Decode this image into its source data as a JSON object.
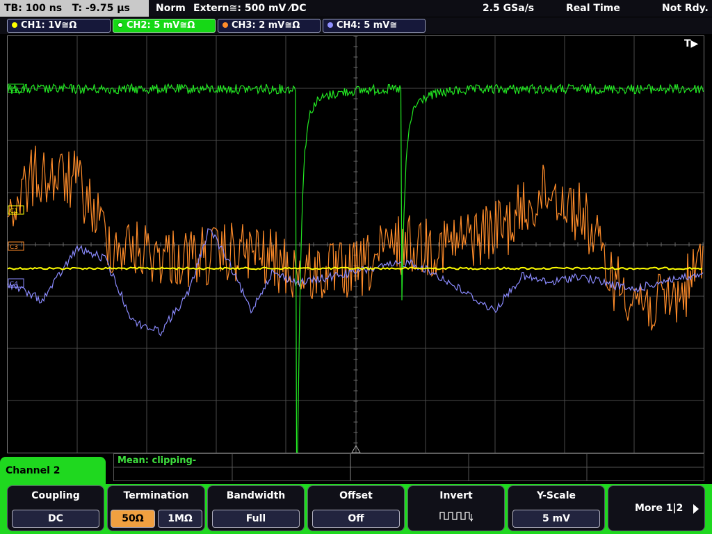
{
  "topbar": {
    "timebase": "TB: 100 ns",
    "trigger_time": "T: -9.75 µs",
    "mode": "Norm",
    "trigger": "Extern≅: 500 mV ⁄DC",
    "sample_rate": "2.5 GSa/s",
    "acq_mode": "Real Time",
    "status": "Not Rdy."
  },
  "channels": [
    {
      "label": "CH1: 1V≅Ω",
      "color": "#ffff00"
    },
    {
      "label": "CH2: 5 mV≅Ω",
      "color": "#22e822"
    },
    {
      "label": "CH3: 2 mV≅Ω",
      "color": "#ff8c2a"
    },
    {
      "label": "CH4: 5 mV≅",
      "color": "#9090ff"
    }
  ],
  "markers": {
    "trigger_flag": "T▶",
    "c1": "C1",
    "c2": "C2",
    "c3": "C3",
    "c4": "C4"
  },
  "measurement": {
    "label": "Mean: clipping-"
  },
  "menu": {
    "channel_tab": "Channel 2",
    "coupling": {
      "title": "Coupling",
      "value": "DC"
    },
    "termination": {
      "title": "Termination",
      "opt1": "50Ω",
      "opt2": "1MΩ"
    },
    "bandwidth": {
      "title": "Bandwidth",
      "value": "Full"
    },
    "offset": {
      "title": "Offset",
      "value": "Off"
    },
    "invert": {
      "title": "Invert",
      "icon": "square-wave-icon"
    },
    "yscale": {
      "title": "Y-Scale",
      "value": "5 mV"
    },
    "more": "More 1|2"
  }
}
